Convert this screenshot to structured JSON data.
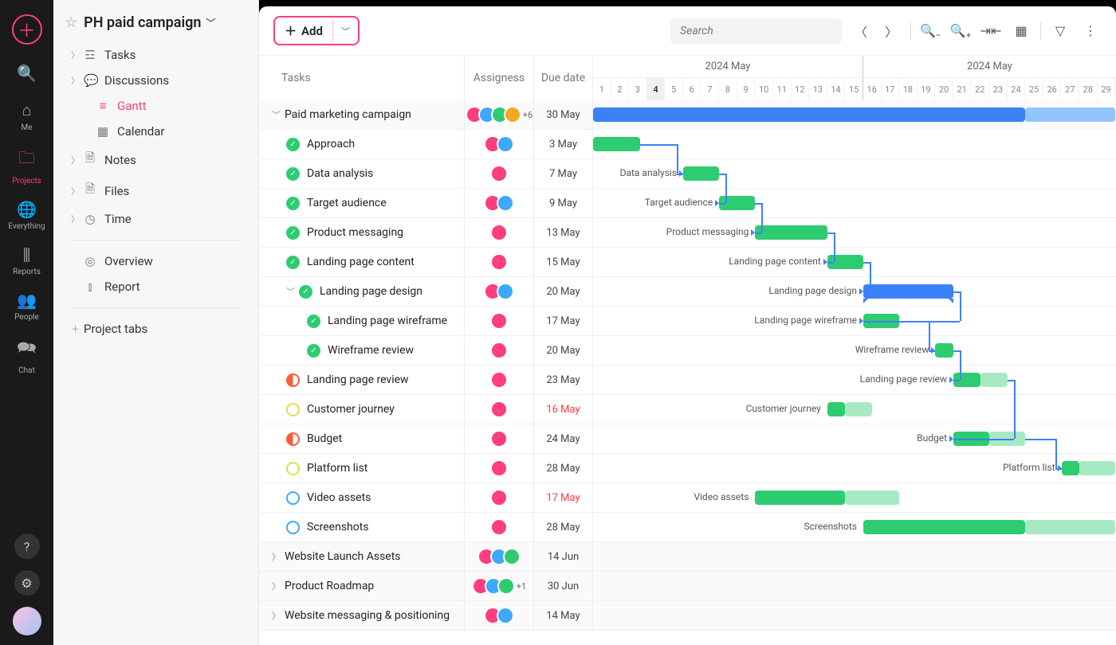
{
  "rail": {
    "items": [
      {
        "label": "Me",
        "icon": "home"
      },
      {
        "label": "Projects",
        "icon": "folder",
        "active": true
      },
      {
        "label": "Everything",
        "icon": "globe"
      },
      {
        "label": "Reports",
        "icon": "bars"
      },
      {
        "label": "People",
        "icon": "people"
      },
      {
        "label": "Chat",
        "icon": "chat"
      }
    ]
  },
  "sidebar": {
    "project_title": "PH paid campaign",
    "nav": [
      {
        "label": "Tasks",
        "icon": "☲",
        "chev": true
      },
      {
        "label": "Discussions",
        "icon": "💬",
        "chev": true
      },
      {
        "label": "Gantt",
        "icon": "≡",
        "active": true,
        "sub": true
      },
      {
        "label": "Calendar",
        "icon": "▦",
        "sub": true
      },
      {
        "label": "Notes",
        "icon": "🗎",
        "chev": true
      },
      {
        "label": "Files",
        "icon": "🗎",
        "chev": true
      },
      {
        "label": "Time",
        "icon": "◷",
        "chev": true
      }
    ],
    "nav2": [
      {
        "label": "Overview",
        "icon": "◎"
      },
      {
        "label": "Report",
        "icon": "⫾"
      }
    ],
    "project_tabs": "Project tabs"
  },
  "toolbar": {
    "add": "Add",
    "search_placeholder": "Search"
  },
  "columns": {
    "tasks": "Tasks",
    "assignees": "Assigness",
    "due": "Due date"
  },
  "timeline": {
    "month_a": "2024 May",
    "month_b": "2024 May",
    "days": [
      1,
      2,
      3,
      4,
      5,
      6,
      7,
      8,
      9,
      10,
      11,
      12,
      13,
      14,
      15,
      16,
      17,
      18,
      19,
      20,
      21,
      22,
      23,
      24,
      25,
      26,
      27,
      28,
      29
    ],
    "today_idx": 3,
    "split_idx": 14
  },
  "avatar_colors": [
    "#ff3d7f",
    "#3da9fc",
    "#2ecc71",
    "#f5a623",
    "#9b59b6",
    "#1abc9c",
    "#e74c3c",
    "#34495e"
  ],
  "rows": [
    {
      "type": "group",
      "indent": 0,
      "name": "Paid marketing campaign",
      "assignees": 4,
      "more": "+6",
      "due": "30 May",
      "bar": {
        "start": 0,
        "len": 24,
        "cls": "bar-blue",
        "tail": 5,
        "tail_cls": "bar-blue-lt"
      }
    },
    {
      "type": "task",
      "indent": 1,
      "status": "done",
      "name": "Approach",
      "assignees": 2,
      "due": "3 May",
      "bar": {
        "start": 0,
        "len": 2.6,
        "cls": "bar-green"
      }
    },
    {
      "type": "task",
      "indent": 1,
      "status": "done",
      "name": "Data analysis",
      "assignees": 1,
      "due": "7 May",
      "bar": {
        "start": 5,
        "len": 2,
        "cls": "bar-green",
        "label": "Data analysis"
      }
    },
    {
      "type": "task",
      "indent": 1,
      "status": "done",
      "name": "Target audience",
      "assignees": 2,
      "due": "9 May",
      "bar": {
        "start": 7,
        "len": 2,
        "cls": "bar-green",
        "label": "Target audience"
      }
    },
    {
      "type": "task",
      "indent": 1,
      "status": "done",
      "name": "Product messaging",
      "assignees": 1,
      "due": "13 May",
      "bar": {
        "start": 9,
        "len": 4,
        "cls": "bar-green",
        "label": "Product messaging"
      }
    },
    {
      "type": "task",
      "indent": 1,
      "status": "done",
      "name": "Landing page content",
      "assignees": 1,
      "due": "15 May",
      "bar": {
        "start": 13,
        "len": 2,
        "cls": "bar-green",
        "label": "Landing page content"
      }
    },
    {
      "type": "group",
      "indent": 1,
      "status": "done",
      "name": "Landing page design",
      "assignees": 2,
      "due": "20 May",
      "bar": {
        "start": 15,
        "len": 5,
        "cls": "bar-summary",
        "label": "Landing page design"
      }
    },
    {
      "type": "task",
      "indent": 2,
      "status": "done",
      "name": "Landing page wireframe",
      "assignees": 1,
      "due": "17 May",
      "bar": {
        "start": 15,
        "len": 2,
        "cls": "bar-green",
        "label": "Landing page wireframe"
      }
    },
    {
      "type": "task",
      "indent": 2,
      "status": "done",
      "name": "Wireframe review",
      "assignees": 1,
      "due": "20 May",
      "bar": {
        "start": 19,
        "len": 1,
        "cls": "bar-green",
        "label": "Wireframe review"
      }
    },
    {
      "type": "task",
      "indent": 1,
      "status": "half-r",
      "name": "Landing page review",
      "assignees": 1,
      "due": "23 May",
      "bar": {
        "start": 20,
        "len": 1.5,
        "cls": "bar-green",
        "tail": 1.5,
        "tail_cls": "bar-green-lt",
        "label": "Landing page review"
      }
    },
    {
      "type": "task",
      "indent": 1,
      "status": "half-y",
      "name": "Customer journey",
      "assignees": 1,
      "due": "16 May",
      "overdue": true,
      "bar": {
        "start": 13,
        "len": 1,
        "cls": "bar-green",
        "tail": 1.5,
        "tail_cls": "bar-green-lt",
        "label": "Customer journey"
      }
    },
    {
      "type": "task",
      "indent": 1,
      "status": "half-r",
      "name": "Budget",
      "assignees": 1,
      "due": "24 May",
      "bar": {
        "start": 20,
        "len": 2,
        "cls": "bar-green",
        "tail": 2,
        "tail_cls": "bar-green-lt",
        "label": "Budget"
      }
    },
    {
      "type": "task",
      "indent": 1,
      "status": "half-y",
      "name": "Platform list",
      "assignees": 1,
      "due": "28 May",
      "bar": {
        "start": 26,
        "len": 1,
        "cls": "bar-green",
        "tail": 2,
        "tail_cls": "bar-green-lt",
        "label": "Platform list"
      }
    },
    {
      "type": "task",
      "indent": 1,
      "status": "half-b",
      "name": "Video assets",
      "assignees": 1,
      "due": "17 May",
      "overdue": true,
      "bar": {
        "start": 9,
        "len": 5,
        "cls": "bar-green",
        "tail": 3,
        "tail_cls": "bar-green-lt",
        "label": "Video assets"
      }
    },
    {
      "type": "task",
      "indent": 1,
      "status": "half-b",
      "name": "Screenshots",
      "assignees": 1,
      "due": "28 May",
      "bar": {
        "start": 15,
        "len": 9,
        "cls": "bar-green",
        "tail": 5,
        "tail_cls": "bar-green-lt",
        "label": "Screenshots"
      }
    },
    {
      "type": "group",
      "indent": 0,
      "name": "Website Launch Assets",
      "assignees": 3,
      "due": "14 Jun"
    },
    {
      "type": "group",
      "indent": 0,
      "name": "Product Roadmap",
      "assignees": 3,
      "more": "+1",
      "due": "30 Jun"
    },
    {
      "type": "group",
      "indent": 0,
      "name": "Website messaging & positioning",
      "assignees": 2,
      "due": "14 May"
    }
  ],
  "deps": [
    {
      "from": 1,
      "to": 2
    },
    {
      "from": 2,
      "to": 3
    },
    {
      "from": 3,
      "to": 4
    },
    {
      "from": 4,
      "to": 5
    },
    {
      "from": 5,
      "to": 6
    },
    {
      "from": 7,
      "to": 8
    },
    {
      "from": 8,
      "to": 9
    },
    {
      "from": 6,
      "to": 7
    },
    {
      "from": 9,
      "to": 11
    },
    {
      "from": 11,
      "to": 12
    }
  ]
}
